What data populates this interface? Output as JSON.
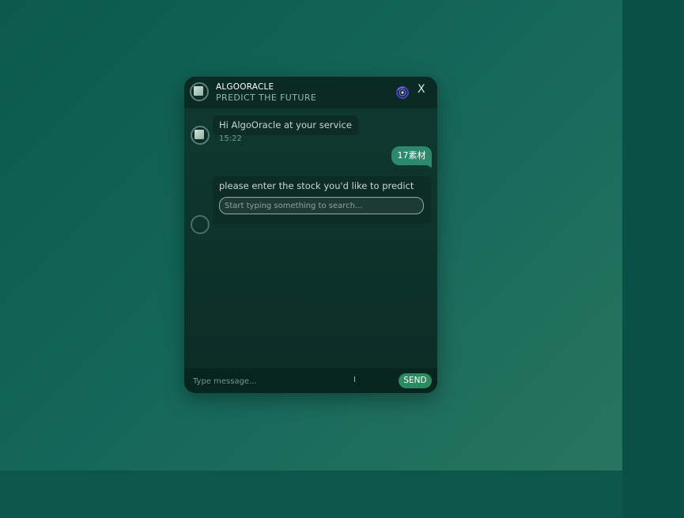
{
  "chat": {
    "title": "ALGOORACLE",
    "subtitle": "PREDICT THE FUTURE",
    "close_label": "X",
    "icons": {
      "header_logo": "broken-image-avatar",
      "status": "swirl-icon",
      "bot_avatar": "broken-image-avatar"
    },
    "messages": [
      {
        "sender": "bot",
        "text": "Hi AlgoOracle at your service",
        "time": "15:22"
      },
      {
        "sender": "user",
        "text": "17素材"
      },
      {
        "sender": "bot",
        "text": "please enter the stock you'd like to predict",
        "search_placeholder": "Start typing something to search..."
      }
    ],
    "input": {
      "placeholder": "Type message...",
      "send_label": "SEND"
    }
  },
  "colors": {
    "page_background": "#15675a",
    "window_background": "#0f3a31",
    "header_background": "#0a2a23",
    "user_bubble": "#2a8a6b",
    "send_button": "#2b8a60",
    "accent_ring": "#5a3fd1"
  }
}
